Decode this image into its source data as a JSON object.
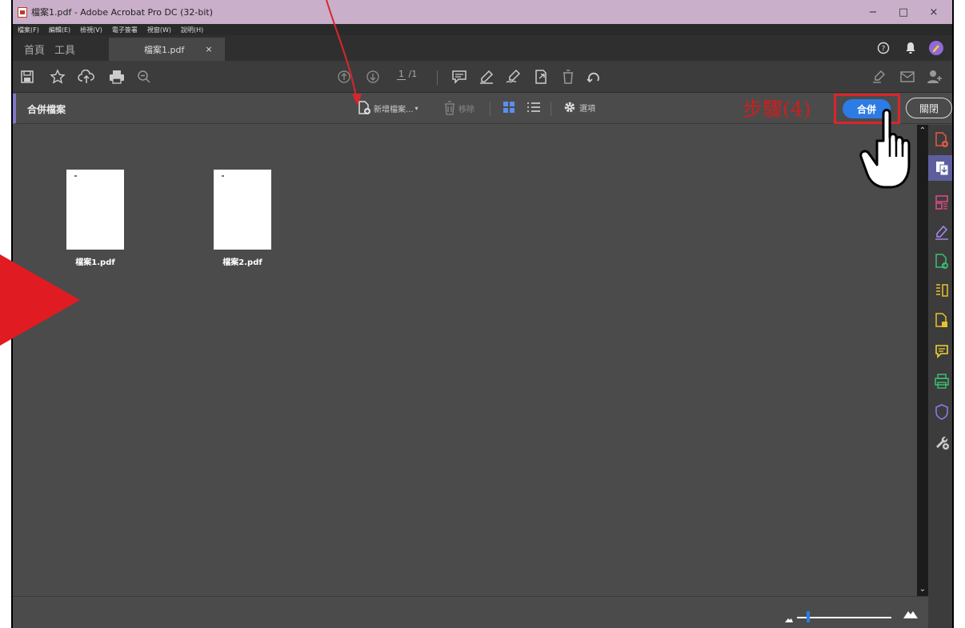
{
  "window": {
    "title": "檔案1.pdf - Adobe Acrobat Pro DC (32-bit)",
    "minimize": "−",
    "maximize": "□",
    "close": "×"
  },
  "menu": [
    "檔案(F)",
    "編輯(E)",
    "檢視(V)",
    "電子簽署",
    "視窗(W)",
    "說明(H)"
  ],
  "tabs": {
    "home": "首頁",
    "tools": "工具",
    "document": "檔案1.pdf",
    "document_close": "×"
  },
  "toolbar": {
    "page_current": "1",
    "page_total": "/1"
  },
  "tool_header": {
    "title": "合併檔案",
    "add_files": "新增檔案...",
    "add_files_caret": "▾",
    "remove": "移除",
    "options": "選項",
    "combine": "合併",
    "close": "關閉"
  },
  "annotation": {
    "step_label": "步驟(4)"
  },
  "files": [
    {
      "name": "檔案1.pdf"
    },
    {
      "name": "檔案2.pdf"
    }
  ],
  "scroll": {
    "up": "⌃",
    "down": "⌄"
  },
  "colors": {
    "accent": "#2d7be5",
    "annotation": "#d8262b",
    "panel_active": "#5e5e9e"
  },
  "zoom": {
    "level_fraction": 0.12
  }
}
